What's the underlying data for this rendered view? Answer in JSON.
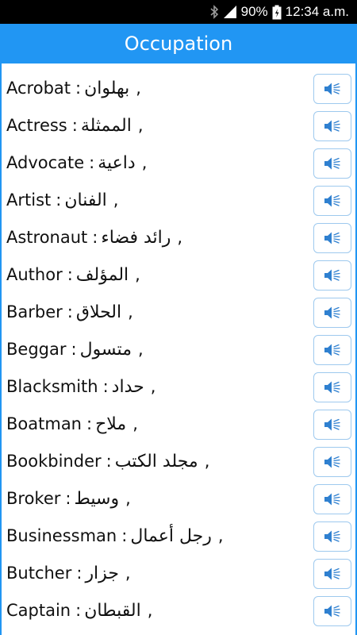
{
  "status_bar": {
    "battery_percent": "90%",
    "time": "12:34 a.m."
  },
  "app_bar": {
    "title": "Occupation"
  },
  "colors": {
    "primary": "#2196f3",
    "status_bar": "#000000",
    "speaker_icon": "#2f80d0"
  },
  "items": [
    {
      "en": "Acrobat",
      "ar": "بهلوان"
    },
    {
      "en": "Actress",
      "ar": "الممثلة"
    },
    {
      "en": "Advocate",
      "ar": "داعية"
    },
    {
      "en": "Artist",
      "ar": "الفنان"
    },
    {
      "en": "Astronaut",
      "ar": "رائد فضاء"
    },
    {
      "en": "Author",
      "ar": "المؤلف"
    },
    {
      "en": "Barber",
      "ar": "الحلاق"
    },
    {
      "en": "Beggar",
      "ar": "متسول"
    },
    {
      "en": "Blacksmith",
      "ar": "حداد"
    },
    {
      "en": "Boatman",
      "ar": "ملاح"
    },
    {
      "en": "Bookbinder",
      "ar": "مجلد الكتب"
    },
    {
      "en": "Broker",
      "ar": "وسيط"
    },
    {
      "en": "Businessman",
      "ar": "رجل أعمال"
    },
    {
      "en": "Butcher",
      "ar": "جزار"
    },
    {
      "en": "Captain",
      "ar": "القبطان"
    }
  ],
  "separator": ":",
  "trailer": ",",
  "icons": {
    "row_button": "speaker-icon"
  }
}
